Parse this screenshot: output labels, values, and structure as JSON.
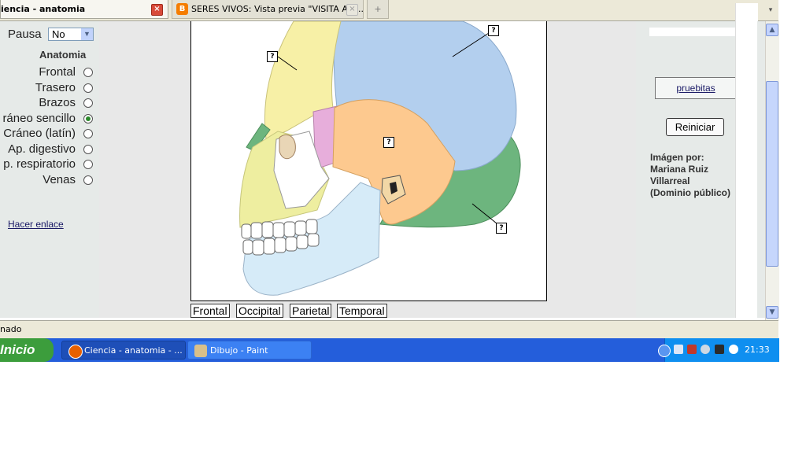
{
  "browser": {
    "tabs": [
      {
        "label": "iencia - anatomia",
        "active": true
      },
      {
        "label": "SERES VIVOS: Vista previa \"VISITA AL ...",
        "active": false
      }
    ],
    "new_tab_glyph": "+",
    "close_glyph": "×",
    "menu_glyph": "▾",
    "status_text": "nado"
  },
  "left_panel": {
    "pausa_label": "Pausa",
    "pausa_value": "No",
    "section_title": "Anatomia",
    "options": [
      {
        "label": "Frontal",
        "selected": false
      },
      {
        "label": "Trasero",
        "selected": false
      },
      {
        "label": "Brazos",
        "selected": false
      },
      {
        "label": "ráneo sencillo",
        "selected": true
      },
      {
        "label": "Cráneo (latín)",
        "selected": false
      },
      {
        "label": "Ap. digestivo",
        "selected": false
      },
      {
        "label": "p. respiratorio",
        "selected": false
      },
      {
        "label": "Venas",
        "selected": false
      }
    ],
    "link_label": "Hacer enlace"
  },
  "quiz": {
    "marker": "?",
    "answer_buttons": [
      "Frontal",
      "Occipital",
      "Parietal",
      "Temporal"
    ]
  },
  "right_panel": {
    "pruebitas_label": "pruebitas",
    "reset_label": "Reiniciar",
    "credit_lines": [
      "Imágen por:",
      "Mariana Ruiz",
      "Villarreal",
      "(Dominio público)"
    ]
  },
  "taskbar": {
    "start_label": "Inicio",
    "items": [
      {
        "label": "Ciencia - anatomia - ..."
      },
      {
        "label": "Dibujo - Paint"
      }
    ],
    "clock": "21:33"
  },
  "colors": {
    "frontal": "#f7f0a6",
    "parietal": "#b3cfee",
    "temporal": "#fdc98f",
    "occipital": "#6db57e",
    "sphenoid": "#e7aedb",
    "maxilla": "#eeeea0",
    "mandible": "#d6ebf8",
    "taskbar": "#245edb",
    "start": "#3c9d3c"
  }
}
